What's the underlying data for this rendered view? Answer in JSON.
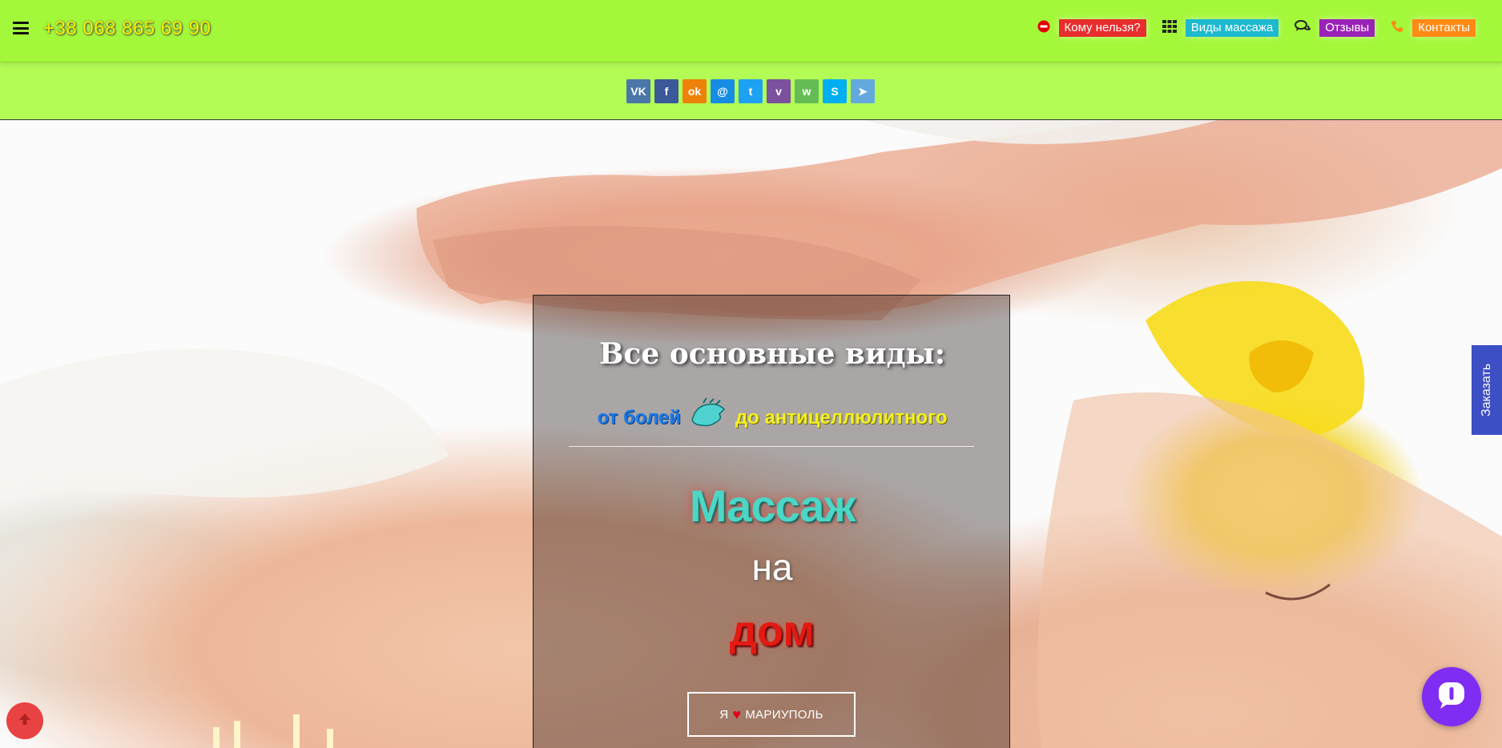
{
  "header": {
    "phone": "+38 068 865 69 90",
    "nav": [
      {
        "label": "Кому нельзя?",
        "icon": "no-entry-icon",
        "color": "#e82d2d"
      },
      {
        "label": "Виды массажа",
        "icon": "grid-icon",
        "color": "#1cb9cf"
      },
      {
        "label": "Отзывы",
        "icon": "comments-icon",
        "color": "#9a22b8"
      },
      {
        "label": "Контакты",
        "icon": "phone-icon",
        "color": "#ff8a14"
      }
    ]
  },
  "share": {
    "buttons": [
      {
        "icon": "vk-icon",
        "label": "VK",
        "color": "#4a76a8"
      },
      {
        "icon": "facebook-icon",
        "label": "f",
        "color": "#3b5998"
      },
      {
        "icon": "odnoklassniki-icon",
        "label": "ok",
        "color": "#ee8208"
      },
      {
        "icon": "moimir-icon",
        "label": "@",
        "color": "#168de2"
      },
      {
        "icon": "twitter-icon",
        "label": "t",
        "color": "#1da1f2"
      },
      {
        "icon": "viber-icon",
        "label": "v",
        "color": "#7b519d"
      },
      {
        "icon": "whatsapp-icon",
        "label": "w",
        "color": "#65bc54"
      },
      {
        "icon": "skype-icon",
        "label": "S",
        "color": "#00aff0"
      },
      {
        "icon": "telegram-icon",
        "label": "➤",
        "color": "#64a9dc"
      }
    ]
  },
  "hero": {
    "title": "Все основные виды:",
    "subtitle_left": "от болей",
    "subtitle_right": "до антицеллюлитного",
    "massage": "Массаж",
    "na": "на",
    "dom": "дом",
    "city_left": "Я",
    "city_right": "МАРИУПОЛЬ"
  },
  "side": {
    "order": "Заказать"
  }
}
